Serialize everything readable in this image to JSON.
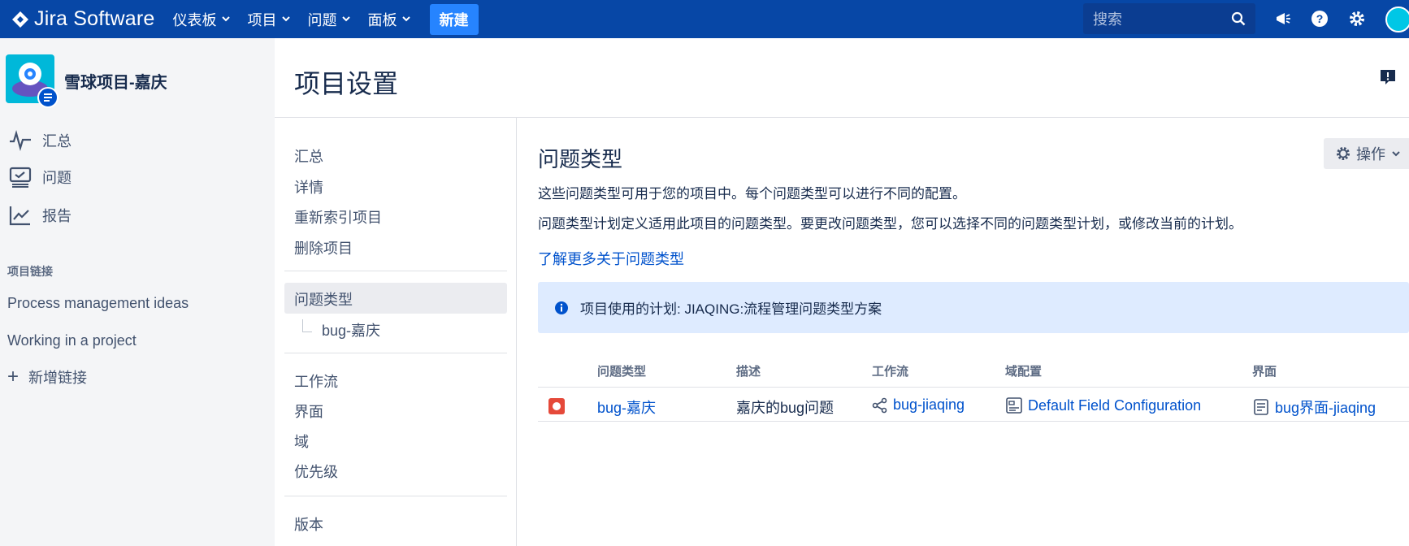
{
  "topbar": {
    "app_name": "Jira Software",
    "nav": [
      "仪表板",
      "项目",
      "问题",
      "面板"
    ],
    "create_label": "新建",
    "search_placeholder": "搜索",
    "colors": {
      "bar": "#0747a6",
      "create": "#2684ff"
    }
  },
  "sidebar": {
    "project_name": "雪球项目-嘉庆",
    "nav": [
      {
        "label": "汇总",
        "icon": "activity-icon"
      },
      {
        "label": "问题",
        "icon": "issues-icon"
      },
      {
        "label": "报告",
        "icon": "reports-icon"
      }
    ],
    "links_heading": "项目链接",
    "links": [
      "Process management ideas",
      "Working in a project"
    ],
    "add_link_label": "新增链接"
  },
  "header": {
    "title": "项目设置"
  },
  "settings_nav": {
    "group1": [
      "汇总",
      "详情",
      "重新索引项目",
      "删除项目"
    ],
    "selected": "问题类型",
    "sub_item": "bug-嘉庆",
    "group2": [
      "工作流",
      "界面",
      "域",
      "优先级"
    ],
    "group3": [
      "版本"
    ]
  },
  "content": {
    "title": "问题类型",
    "actions_label": "操作",
    "desc1": "这些问题类型可用于您的项目中。每个问题类型可以进行不同的配置。",
    "desc2": "问题类型计划定义适用此项目的问题类型。要更改问题类型，您可以选择不同的问题类型计划，或修改当前的计划。",
    "learn_more": "了解更多关于问题类型",
    "info": "项目使用的计划: JIAQING:流程管理问题类型方案",
    "table": {
      "headers": [
        "问题类型",
        "描述",
        "工作流",
        "域配置",
        "界面"
      ],
      "rows": [
        {
          "type": "bug-嘉庆",
          "type_icon": "bug-icon",
          "description": "嘉庆的bug问题",
          "workflow": "bug-jiaqing",
          "field_config": "Default Field Configuration",
          "screen": "bug界面-jiaqing"
        }
      ]
    }
  }
}
